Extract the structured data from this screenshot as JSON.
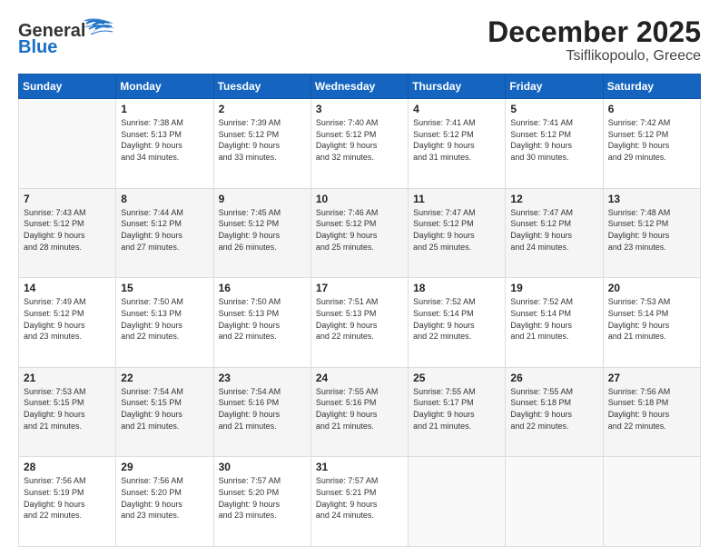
{
  "header": {
    "logo_general": "General",
    "logo_blue": "Blue",
    "title": "December 2025",
    "subtitle": "Tsiflikopoulo, Greece"
  },
  "days_of_week": [
    "Sunday",
    "Monday",
    "Tuesday",
    "Wednesday",
    "Thursday",
    "Friday",
    "Saturday"
  ],
  "weeks": [
    [
      {
        "day": "",
        "info": ""
      },
      {
        "day": "1",
        "info": "Sunrise: 7:38 AM\nSunset: 5:13 PM\nDaylight: 9 hours\nand 34 minutes."
      },
      {
        "day": "2",
        "info": "Sunrise: 7:39 AM\nSunset: 5:12 PM\nDaylight: 9 hours\nand 33 minutes."
      },
      {
        "day": "3",
        "info": "Sunrise: 7:40 AM\nSunset: 5:12 PM\nDaylight: 9 hours\nand 32 minutes."
      },
      {
        "day": "4",
        "info": "Sunrise: 7:41 AM\nSunset: 5:12 PM\nDaylight: 9 hours\nand 31 minutes."
      },
      {
        "day": "5",
        "info": "Sunrise: 7:41 AM\nSunset: 5:12 PM\nDaylight: 9 hours\nand 30 minutes."
      },
      {
        "day": "6",
        "info": "Sunrise: 7:42 AM\nSunset: 5:12 PM\nDaylight: 9 hours\nand 29 minutes."
      }
    ],
    [
      {
        "day": "7",
        "info": "Sunrise: 7:43 AM\nSunset: 5:12 PM\nDaylight: 9 hours\nand 28 minutes."
      },
      {
        "day": "8",
        "info": "Sunrise: 7:44 AM\nSunset: 5:12 PM\nDaylight: 9 hours\nand 27 minutes."
      },
      {
        "day": "9",
        "info": "Sunrise: 7:45 AM\nSunset: 5:12 PM\nDaylight: 9 hours\nand 26 minutes."
      },
      {
        "day": "10",
        "info": "Sunrise: 7:46 AM\nSunset: 5:12 PM\nDaylight: 9 hours\nand 25 minutes."
      },
      {
        "day": "11",
        "info": "Sunrise: 7:47 AM\nSunset: 5:12 PM\nDaylight: 9 hours\nand 25 minutes."
      },
      {
        "day": "12",
        "info": "Sunrise: 7:47 AM\nSunset: 5:12 PM\nDaylight: 9 hours\nand 24 minutes."
      },
      {
        "day": "13",
        "info": "Sunrise: 7:48 AM\nSunset: 5:12 PM\nDaylight: 9 hours\nand 23 minutes."
      }
    ],
    [
      {
        "day": "14",
        "info": "Sunrise: 7:49 AM\nSunset: 5:12 PM\nDaylight: 9 hours\nand 23 minutes."
      },
      {
        "day": "15",
        "info": "Sunrise: 7:50 AM\nSunset: 5:13 PM\nDaylight: 9 hours\nand 22 minutes."
      },
      {
        "day": "16",
        "info": "Sunrise: 7:50 AM\nSunset: 5:13 PM\nDaylight: 9 hours\nand 22 minutes."
      },
      {
        "day": "17",
        "info": "Sunrise: 7:51 AM\nSunset: 5:13 PM\nDaylight: 9 hours\nand 22 minutes."
      },
      {
        "day": "18",
        "info": "Sunrise: 7:52 AM\nSunset: 5:14 PM\nDaylight: 9 hours\nand 22 minutes."
      },
      {
        "day": "19",
        "info": "Sunrise: 7:52 AM\nSunset: 5:14 PM\nDaylight: 9 hours\nand 21 minutes."
      },
      {
        "day": "20",
        "info": "Sunrise: 7:53 AM\nSunset: 5:14 PM\nDaylight: 9 hours\nand 21 minutes."
      }
    ],
    [
      {
        "day": "21",
        "info": "Sunrise: 7:53 AM\nSunset: 5:15 PM\nDaylight: 9 hours\nand 21 minutes."
      },
      {
        "day": "22",
        "info": "Sunrise: 7:54 AM\nSunset: 5:15 PM\nDaylight: 9 hours\nand 21 minutes."
      },
      {
        "day": "23",
        "info": "Sunrise: 7:54 AM\nSunset: 5:16 PM\nDaylight: 9 hours\nand 21 minutes."
      },
      {
        "day": "24",
        "info": "Sunrise: 7:55 AM\nSunset: 5:16 PM\nDaylight: 9 hours\nand 21 minutes."
      },
      {
        "day": "25",
        "info": "Sunrise: 7:55 AM\nSunset: 5:17 PM\nDaylight: 9 hours\nand 21 minutes."
      },
      {
        "day": "26",
        "info": "Sunrise: 7:55 AM\nSunset: 5:18 PM\nDaylight: 9 hours\nand 22 minutes."
      },
      {
        "day": "27",
        "info": "Sunrise: 7:56 AM\nSunset: 5:18 PM\nDaylight: 9 hours\nand 22 minutes."
      }
    ],
    [
      {
        "day": "28",
        "info": "Sunrise: 7:56 AM\nSunset: 5:19 PM\nDaylight: 9 hours\nand 22 minutes."
      },
      {
        "day": "29",
        "info": "Sunrise: 7:56 AM\nSunset: 5:20 PM\nDaylight: 9 hours\nand 23 minutes."
      },
      {
        "day": "30",
        "info": "Sunrise: 7:57 AM\nSunset: 5:20 PM\nDaylight: 9 hours\nand 23 minutes."
      },
      {
        "day": "31",
        "info": "Sunrise: 7:57 AM\nSunset: 5:21 PM\nDaylight: 9 hours\nand 24 minutes."
      },
      {
        "day": "",
        "info": ""
      },
      {
        "day": "",
        "info": ""
      },
      {
        "day": "",
        "info": ""
      }
    ]
  ]
}
